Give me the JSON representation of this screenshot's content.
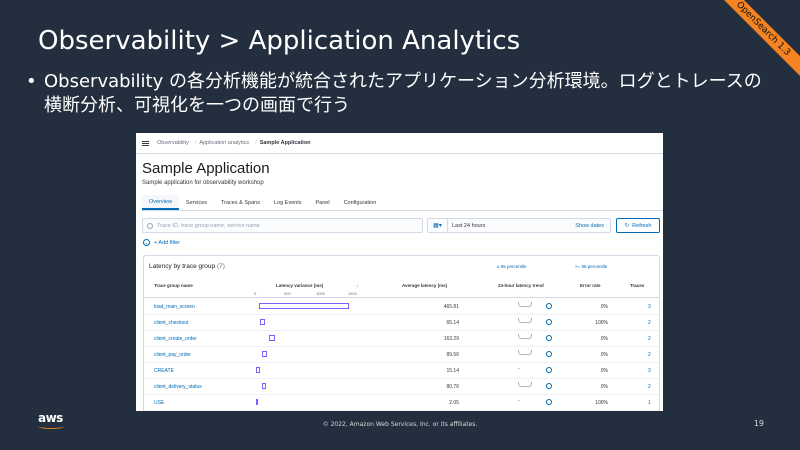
{
  "slide": {
    "badge": "OpenSearch 1.3",
    "title": "Observability > Application Analytics",
    "bullet": "Observability の各分析機能が統合されたアプリケーション分析環境。ログとトレースの横断分析、可視化を一つの画面で行う",
    "footer": "© 2022, Amazon Web Services, Inc. or its affiliates.",
    "page_number": "19",
    "logo": "aws"
  },
  "screenshot": {
    "breadcrumbs": [
      "Observability",
      "Application analytics",
      "Sample Application"
    ],
    "app_title": "Sample Application",
    "app_subtitle": "Sample application for observability workshop",
    "tabs": [
      "Overview",
      "Services",
      "Traces & Spans",
      "Log Events",
      "Panel",
      "Configuration"
    ],
    "active_tab": "Overview",
    "search_placeholder": "Trace ID, trace group name, service name",
    "time_range": "Last 24 hours",
    "show_dates": "Show dates",
    "refresh": "Refresh",
    "add_filter": "+ Add filter",
    "panel_title": "Latency by trace group",
    "panel_count": "(7)",
    "legend_lt": "≤ 95 percentile",
    "legend_ge": ">= 95 percentile",
    "columns": [
      "Trace group name",
      "Latency variance (ms)",
      "Average latency (ms)",
      "24-hour latency trend",
      "Error rate",
      "Traces"
    ],
    "axis_ticks": [
      "0",
      "500",
      "1000",
      "1500"
    ],
    "rows": [
      {
        "name": "load_main_screen",
        "avg": "465.81",
        "trend": "\\____/",
        "error": "0%",
        "traces": "3",
        "variance_start": 30,
        "variance_end": 1010
      },
      {
        "name": "client_checkout",
        "avg": "65.14",
        "trend": "\\____/",
        "error": "100%",
        "traces": "2",
        "variance_start": 40,
        "variance_end": 90
      },
      {
        "name": "client_create_order",
        "avg": "163.29",
        "trend": "\\____/",
        "error": "0%",
        "traces": "2",
        "variance_start": 130,
        "variance_end": 190
      },
      {
        "name": "client_pay_order",
        "avg": "89.56",
        "trend": "\\____/",
        "error": "0%",
        "traces": "2",
        "variance_start": 60,
        "variance_end": 110
      },
      {
        "name": "CREATE",
        "avg": "15.14",
        "trend": "-",
        "error": "0%",
        "traces": "3",
        "variance_start": 5,
        "variance_end": 40
      },
      {
        "name": "client_delivery_status",
        "avg": "80.76",
        "trend": "\\____/",
        "error": "0%",
        "traces": "2",
        "variance_start": 60,
        "variance_end": 100
      },
      {
        "name": "USE",
        "avg": "2.05",
        "trend": "-",
        "error": "100%",
        "traces": "1",
        "variance_start": 0,
        "variance_end": 10
      }
    ]
  }
}
